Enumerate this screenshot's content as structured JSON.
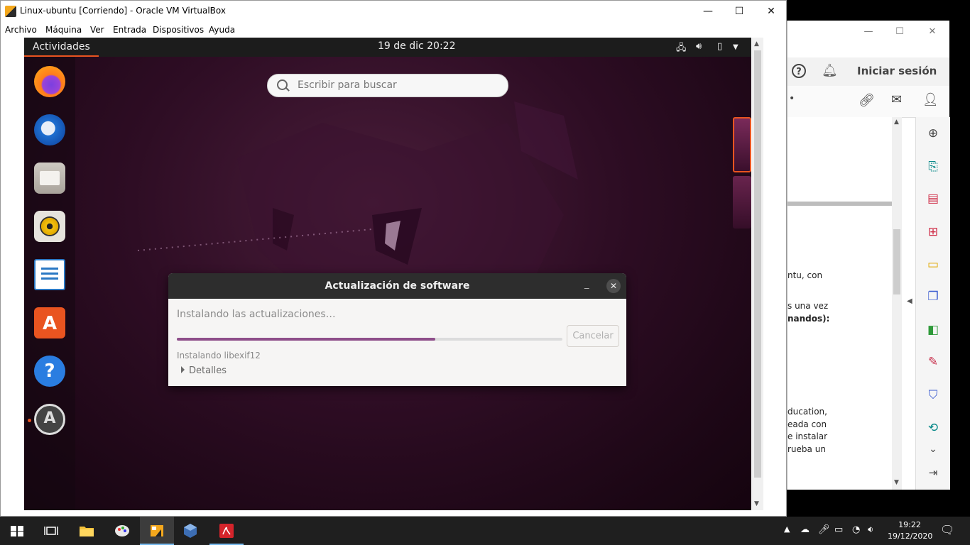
{
  "acrobat": {
    "signin": "Iniciar sesión",
    "doc_lines": [
      "ntu, con",
      "s una vez",
      "nandos):",
      "ducation,",
      "eada  con",
      "e instalar",
      "rueba un"
    ],
    "toolbar_dot": "•"
  },
  "vbox": {
    "window_title": "Linux-ubuntu [Corriendo] - Oracle VM VirtualBox",
    "menu": [
      "Archivo",
      "Máquina",
      "Ver",
      "Entrada",
      "Dispositivos",
      "Ayuda"
    ]
  },
  "ubuntu": {
    "activities": "Actividades",
    "clock": "19 de dic  20:22",
    "search_placeholder": "Escribir para buscar",
    "dock_apps": [
      "firefox",
      "thunderbird",
      "files",
      "rhythmbox",
      "libreoffice-writer",
      "ubuntu-software",
      "help",
      "software-updater"
    ]
  },
  "dialog": {
    "title": "Actualización de software",
    "status": "Instalando las actualizaciones…",
    "progress": 0.67,
    "cancel_label": "Cancelar",
    "sub_status": "Instalando libexif12",
    "details_label": "Detalles"
  },
  "taskbar": {
    "time": "19:22",
    "date": "19/12/2020"
  },
  "colors": {
    "ubuntu_orange": "#e95420",
    "progress_purple": "#8e4e8a",
    "taskbar": "#1f1f1f"
  }
}
